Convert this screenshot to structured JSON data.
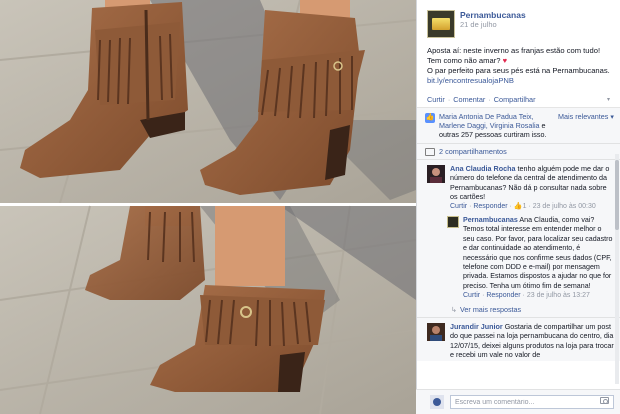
{
  "post": {
    "page_name": "Pernambucanas",
    "date": "21 de julho",
    "text_lines": [
      "Aposta aí: neste inverno as franjas estão com tudo!",
      "Tem como não amar?",
      "O par perfeito para seus pés está na Pernambucanas."
    ],
    "link": "bit.ly/encontresualojaPNB",
    "actions": {
      "like": "Curtir",
      "comment": "Comentar",
      "share": "Compartilhar"
    }
  },
  "ufi": {
    "likes_names": "Maria Antonia De Padua Teix, Marlene Daggi, Virginia Rosalia",
    "likes_suffix": "e outras 257 pessoas curtiram isso.",
    "sort_label": "Mais relevantes",
    "shares": "2 compartilhamentos"
  },
  "comments": [
    {
      "name": "Ana Claudia Rocha",
      "text": "tenho alguém pode me dar o número do telefone da central de atendimento da Pernambucanas? Não dá p consultar nada sobre os cartões!",
      "meta_like": "Curtir",
      "meta_reply": "Responder",
      "likes": "1",
      "time": "23 de julho às 00:30"
    }
  ],
  "reply": {
    "name": "Pernambucanas",
    "text": "Ana Claudia, como vai? Temos total interesse em entender melhor o seu caso. Por favor, para localizar seu cadastro e dar continuidade ao atendimento, é necessário que nos confirme seus dados (CPF, telefone com DDD e e-mail) por mensagem privada. Estamos dispostos a ajudar no que for preciso. Tenha um ótimo fim de semana!",
    "meta_like": "Curtir",
    "meta_reply": "Responder",
    "time": "23 de julho às 13:27"
  },
  "more_replies": "Ver mais respostas",
  "second_comment": {
    "name": "Jurandir Junior",
    "text": "Gostaria de compartilhar um post do que passei na loja pernambucana do centro, dia 12/07/15, deixei alguns produtos na loja para trocar e recebi um vale no valor de"
  },
  "composer": {
    "placeholder": "Escreva um comentário..."
  },
  "colors": {
    "link": "#3b5998",
    "meta": "#9197a3",
    "heart": "#e2264d"
  },
  "icons": [
    "like-icon",
    "share-icon",
    "heart-icon",
    "camera-icon",
    "chevron-down-icon"
  ]
}
